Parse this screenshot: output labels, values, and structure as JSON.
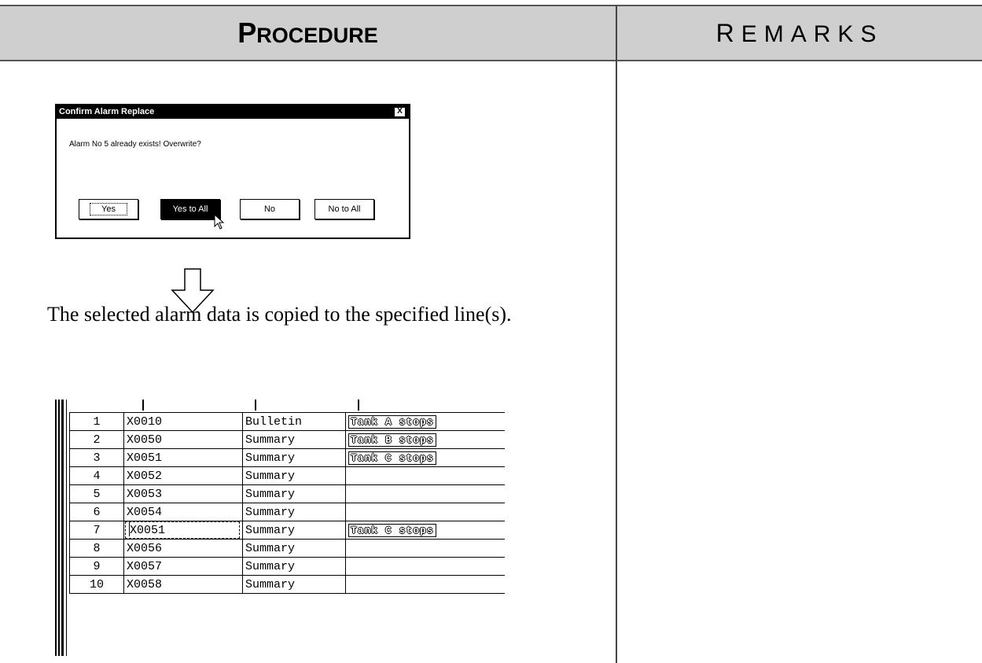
{
  "header": {
    "procedure": {
      "first": "P",
      "rest": "ROCEDURE"
    },
    "remarks": {
      "first": "R",
      "rest": "EMARKS"
    }
  },
  "dialog": {
    "title": "Confirm Alarm Replace",
    "close_label": "X",
    "message": "Alarm No 5 already exists! Overwrite?",
    "buttons": {
      "yes": "Yes",
      "yes_to_all": "Yes to All",
      "no": "No",
      "no_to_all": "No to All"
    }
  },
  "caption": "The selected alarm data is copied to the specified line(s).",
  "table": {
    "rows": [
      {
        "num": "1",
        "address": "X0010",
        "type": "Bulletin",
        "message": "Tank A stops"
      },
      {
        "num": "2",
        "address": "X0050",
        "type": "Summary",
        "message": "Tank B stops"
      },
      {
        "num": "3",
        "address": "X0051",
        "type": "Summary",
        "message": "Tank C stops"
      },
      {
        "num": "4",
        "address": "X0052",
        "type": "Summary",
        "message": ""
      },
      {
        "num": "5",
        "address": "X0053",
        "type": "Summary",
        "message": ""
      },
      {
        "num": "6",
        "address": "X0054",
        "type": "Summary",
        "message": ""
      },
      {
        "num": "7",
        "address": "X0051",
        "type": "Summary",
        "message": "Tank C stops"
      },
      {
        "num": "8",
        "address": "X0056",
        "type": "Summary",
        "message": ""
      },
      {
        "num": "9",
        "address": "X0057",
        "type": "Summary",
        "message": ""
      },
      {
        "num": "10",
        "address": "X0058",
        "type": "Summary",
        "message": ""
      }
    ]
  }
}
